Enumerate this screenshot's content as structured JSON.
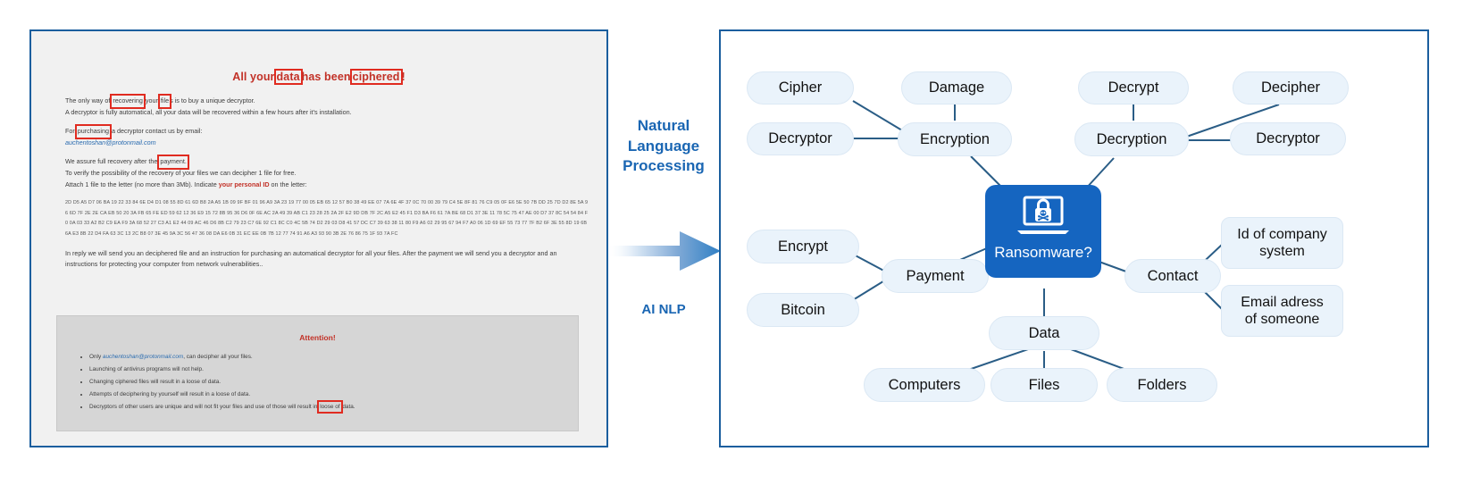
{
  "note": {
    "title_parts": [
      {
        "text": "All your ",
        "box": false
      },
      {
        "text": "data",
        "box": true
      },
      {
        "text": " has been ",
        "box": false
      },
      {
        "text": "ciphered",
        "box": true
      },
      {
        "text": "!",
        "box": false
      }
    ],
    "title_plain": "All your data has been ciphered!",
    "para1_a": "The only way of ",
    "para1_hl1": "recovering",
    "para1_b": " your ",
    "para1_hl2": "file",
    "para1_c": "s is to buy a unique decryptor.",
    "para1_line2": "A decryptor is fully automatical, all your data will be recovered within a few hours after it's installation.",
    "para2_a": "For ",
    "para2_hl": "purchasing",
    "para2_b": " a decryptor contact us by email:",
    "email": "auchentoshan@protonmail.com",
    "para3_a": "We assure full recovery after the ",
    "para3_hl": "payment.",
    "para3_line2": "To verify the possibility of the recovery of your files we can decipher 1 file for free.",
    "para3_line3_a": "Attach 1 file to the letter (no more than 3Mb). Indicate ",
    "para3_line3_bold": "your personal ID",
    "para3_line3_b": " on the letter:",
    "hex": "2D D5 A5 D7 06 BA 19 22 33 84 6E D4 D1 08 55 8D 61 6D B8 2A A5 1B 09 9F BF 01 96 A9 3A 23 19 77 00 05 EB 65 12 57 B0 38 49 EE 07 7A 6E 4F 37 0C 70 00 39 79 C4 5E 8F 81 76 C9 05 0F E6 5E 50 7B DD 25 7D D2 8E 5A 96 6D 7F 2E 2E CA EB 50 20 3A FB 65 FE ED 59 62 12 36 E9 15 72 8B 95 36 D6 0F 6E AC 2A 49 39 AB C1 23 28 25 2A 2F E2 9D DB 7F 2C A5 E2 45 F1 D3 BA F6 61 7A BE 68 D1 37 3E 11 78 5C 75 47 AE 00 D7 37 8C 54 54 84 F0 0A 03 33 A2 B2 C9 EA F9 3A 68 52 27 C3 A1 E2 44 09 AC 46 D6 8B C2 79 23 C7 6E 92 C1 8C C0 4C 5B 74 D2 29 03 D8 41 57 DC C7 39 63 38 11 80 F9 A6 02 29 95 67 94 F7 A0 06 1D 69 EF 55 73 77 7F B2 6F 3E 55 8D 19 6B 6A E3 8B 22 D4 FA 63 3C 13 2C B8 07 3E 45 9A 3C 56 47 36 08 DA E6 0B 31 EC EE 0B 7B 12 77 74 91 A6 A3 93 90 3B 2E 76 86 75 1F 93 7A FC",
    "para4": "In reply we will send you an deciphered file and an instruction for purchasing an automatical decryptor for all your files. After the payment we will send you a decryptor and an instructions for protecting your computer from network vulnerabilities..",
    "attention_title": "Attention!",
    "bullets": [
      {
        "pre": "Only ",
        "link": "auchentoshan@protonmail.com",
        "post": ", can decipher all your files."
      },
      {
        "pre": "Launching of antivirus programs will not help.",
        "link": "",
        "post": ""
      },
      {
        "pre": "Changing ciphered files will result in a loose of data.",
        "link": "",
        "post": ""
      },
      {
        "pre": "Attempts of deciphering by yourself will result in a loose of data.",
        "link": "",
        "post": ""
      },
      {
        "pre": "Decryptors of other users are unique and will not fit your files and use of those will result in ",
        "link": "",
        "post": " data.",
        "hl": "loose of"
      }
    ],
    "bullet5_pre": "Decryptors of other users are unique and will not fit your files and use of those will result in ",
    "bullet5_hl": "loose of",
    "bullet5_post": " data."
  },
  "middle": {
    "nlp_line1": "Natural",
    "nlp_line2": "Language",
    "nlp_line3": "Processing",
    "ai_nlp": "AI NLP",
    "arrow_icon": "right-arrow-icon",
    "accent_color": "#1a66b3",
    "arrow_color_start": "#eef5fc",
    "arrow_color_end": "#3f84c9"
  },
  "mindmap": {
    "center": {
      "label": "Ransomware?",
      "icon": "laptop-lock-skull-icon",
      "color": "#1565c0"
    },
    "node_fill": "#eaf3fb",
    "edge_color": "#2a5d86",
    "nodes": [
      {
        "id": "cipher",
        "label": "Cipher"
      },
      {
        "id": "damage",
        "label": "Damage"
      },
      {
        "id": "decrypt",
        "label": "Decrypt"
      },
      {
        "id": "decipher",
        "label": "Decipher"
      },
      {
        "id": "decryptor1",
        "label": "Decryptor"
      },
      {
        "id": "encryption",
        "label": "Encryption"
      },
      {
        "id": "decryption",
        "label": "Decryption"
      },
      {
        "id": "decryptor2",
        "label": "Decryptor"
      },
      {
        "id": "encrypt",
        "label": "Encrypt"
      },
      {
        "id": "bitcoin",
        "label": "Bitcoin"
      },
      {
        "id": "payment",
        "label": "Payment"
      },
      {
        "id": "contact",
        "label": "Contact"
      },
      {
        "id": "idcompany",
        "label": "Id of company\nsystem"
      },
      {
        "id": "emailadr",
        "label": "Email adress\nof someone"
      },
      {
        "id": "data",
        "label": "Data"
      },
      {
        "id": "computers",
        "label": "Computers"
      },
      {
        "id": "files",
        "label": "Files"
      },
      {
        "id": "folders",
        "label": "Folders"
      }
    ]
  }
}
